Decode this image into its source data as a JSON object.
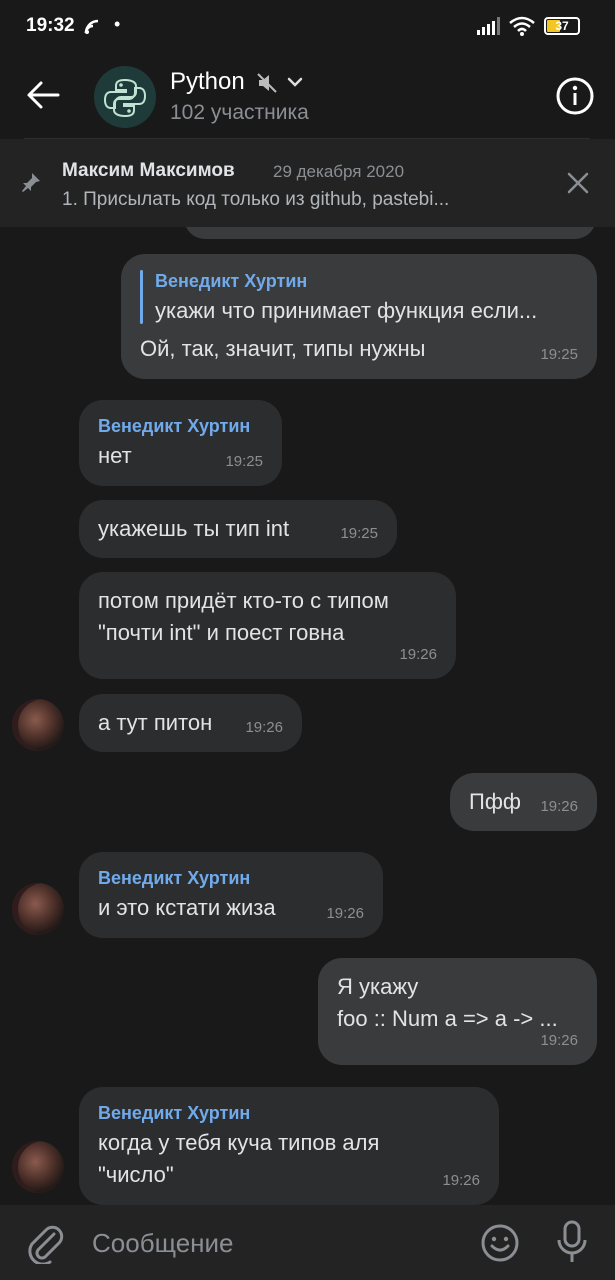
{
  "status": {
    "time": "19:32",
    "battery": "37"
  },
  "header": {
    "title": "Python",
    "subtitle": "102 участника"
  },
  "pinned": {
    "author": "Максим Максимов",
    "date": "29 декабря 2020",
    "text": "1. Присылать код только из  github, pastebi..."
  },
  "messages": [
    {
      "direction": "out",
      "reply_author": "Венедикт Хуртин",
      "reply_text": "укажи что принимает функция если...",
      "text": "Ой, так, значит, типы нужны",
      "time": "19:25"
    },
    {
      "direction": "in",
      "sender": "Венедикт Хуртин",
      "text": "нет",
      "time": "19:25"
    },
    {
      "direction": "in",
      "text": "укажешь ты тип int",
      "time": "19:25"
    },
    {
      "direction": "in",
      "text_lines": [
        "потом придёт кто-то с типом",
        "\"почти int\" и поест говна"
      ],
      "time": "19:26"
    },
    {
      "direction": "in",
      "text": "а тут питон",
      "time": "19:26"
    },
    {
      "direction": "out",
      "text": "Пфф",
      "time": "19:26"
    },
    {
      "direction": "in",
      "sender": "Венедикт Хуртин",
      "text": "и это кстати жиза",
      "time": "19:26"
    },
    {
      "direction": "out",
      "text_lines": [
        "Я укажу",
        "foo :: Num a => a -> ..."
      ],
      "time": "19:26"
    },
    {
      "direction": "in",
      "sender": "Венедикт Хуртин",
      "text_lines": [
        "когда у тебя куча типов аля",
        "\"число\""
      ],
      "time": "19:26"
    }
  ],
  "composer": {
    "placeholder": "Сообщение"
  },
  "colors": {
    "background": "#191919",
    "bubble_in": "#2c2d2e",
    "bubble_out": "#3a3b3c",
    "accent": "#71aaeb"
  }
}
